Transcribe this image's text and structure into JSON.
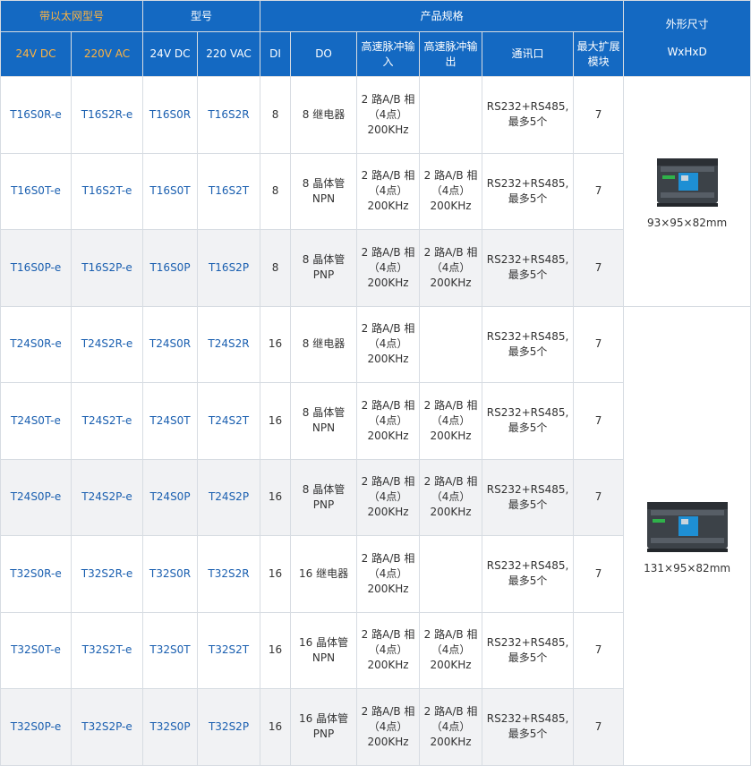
{
  "header": {
    "group_ethernet": "带以太网型号",
    "group_model": "型号",
    "group_spec": "产品规格",
    "group_dims": "外形尺寸",
    "dims_unit": "WxHxD",
    "col_24vdc_e": "24V DC",
    "col_220vac_e": "220V AC",
    "col_24vdc": "24V DC",
    "col_220vac": "220 VAC",
    "col_di": "DI",
    "col_do": "DO",
    "col_hs_in": "高速脉冲输入",
    "col_hs_out": "高速脉冲输出",
    "col_comm": "通讯口",
    "col_ext": "最大扩展模块"
  },
  "rows": [
    {
      "m1": "T16S0R-e",
      "m2": "T16S2R-e",
      "m3": "T16S0R",
      "m4": "T16S2R",
      "di": "8",
      "do": "8 继电器",
      "hin": "2 路A/B 相 （4点） 200KHz",
      "hout": "",
      "comm": "RS232+RS485, 最多5个",
      "ext": "7"
    },
    {
      "m1": "T16S0T-e",
      "m2": "T16S2T-e",
      "m3": "T16S0T",
      "m4": "T16S2T",
      "di": "8",
      "do": "8 晶体管 NPN",
      "hin": "2 路A/B 相 （4点） 200KHz",
      "hout": "2 路A/B 相 （4点） 200KHz",
      "comm": "RS232+RS485, 最多5个",
      "ext": "7"
    },
    {
      "m1": "T16S0P-e",
      "m2": "T16S2P-e",
      "m3": "T16S0P",
      "m4": "T16S2P",
      "di": "8",
      "do": "8 晶体管 PNP",
      "hin": "2 路A/B 相 （4点） 200KHz",
      "hout": "2 路A/B 相 （4点） 200KHz",
      "comm": "RS232+RS485, 最多5个",
      "ext": "7"
    },
    {
      "m1": "T24S0R-e",
      "m2": "T24S2R-e",
      "m3": "T24S0R",
      "m4": "T24S2R",
      "di": "16",
      "do": "8 继电器",
      "hin": "2 路A/B 相 （4点） 200KHz",
      "hout": "",
      "comm": "RS232+RS485, 最多5个",
      "ext": "7"
    },
    {
      "m1": "T24S0T-e",
      "m2": "T24S2T-e",
      "m3": "T24S0T",
      "m4": "T24S2T",
      "di": "16",
      "do": "8 晶体管 NPN",
      "hin": "2 路A/B 相 （4点） 200KHz",
      "hout": "2 路A/B 相 （4点） 200KHz",
      "comm": "RS232+RS485, 最多5个",
      "ext": "7"
    },
    {
      "m1": "T24S0P-e",
      "m2": "T24S2P-e",
      "m3": "T24S0P",
      "m4": "T24S2P",
      "di": "16",
      "do": "8 晶体管 PNP",
      "hin": "2 路A/B 相 （4点） 200KHz",
      "hout": "2 路A/B 相 （4点） 200KHz",
      "comm": "RS232+RS485, 最多5个",
      "ext": "7"
    },
    {
      "m1": "T32S0R-e",
      "m2": "T32S2R-e",
      "m3": "T32S0R",
      "m4": "T32S2R",
      "di": "16",
      "do": "16 继电器",
      "hin": "2 路A/B 相 （4点） 200KHz",
      "hout": "",
      "comm": "RS232+RS485, 最多5个",
      "ext": "7"
    },
    {
      "m1": "T32S0T-e",
      "m2": "T32S2T-e",
      "m3": "T32S0T",
      "m4": "T32S2T",
      "di": "16",
      "do": "16 晶体管 NPN",
      "hin": "2 路A/B 相 （4点） 200KHz",
      "hout": "2 路A/B 相 （4点） 200KHz",
      "comm": "RS232+RS485, 最多5个",
      "ext": "7"
    },
    {
      "m1": "T32S0P-e",
      "m2": "T32S2P-e",
      "m3": "T32S0P",
      "m4": "T32S2P",
      "di": "16",
      "do": "16 晶体管 PNP",
      "hin": "2 路A/B 相 （4点） 200KHz",
      "hout": "2 路A/B 相 （4点） 200KHz",
      "comm": "RS232+RS485, 最多5个",
      "ext": "7"
    }
  ],
  "dims": [
    {
      "size": "93×95×82mm",
      "image": "plc-16-point-image"
    },
    {
      "size": "131×95×82mm",
      "image": "plc-24-32-point-image"
    }
  ],
  "colors": {
    "header_bg": "#1469c2",
    "header_orange": "#ffb33f",
    "link_blue": "#1a5fb0",
    "shade": "#f1f2f4"
  }
}
